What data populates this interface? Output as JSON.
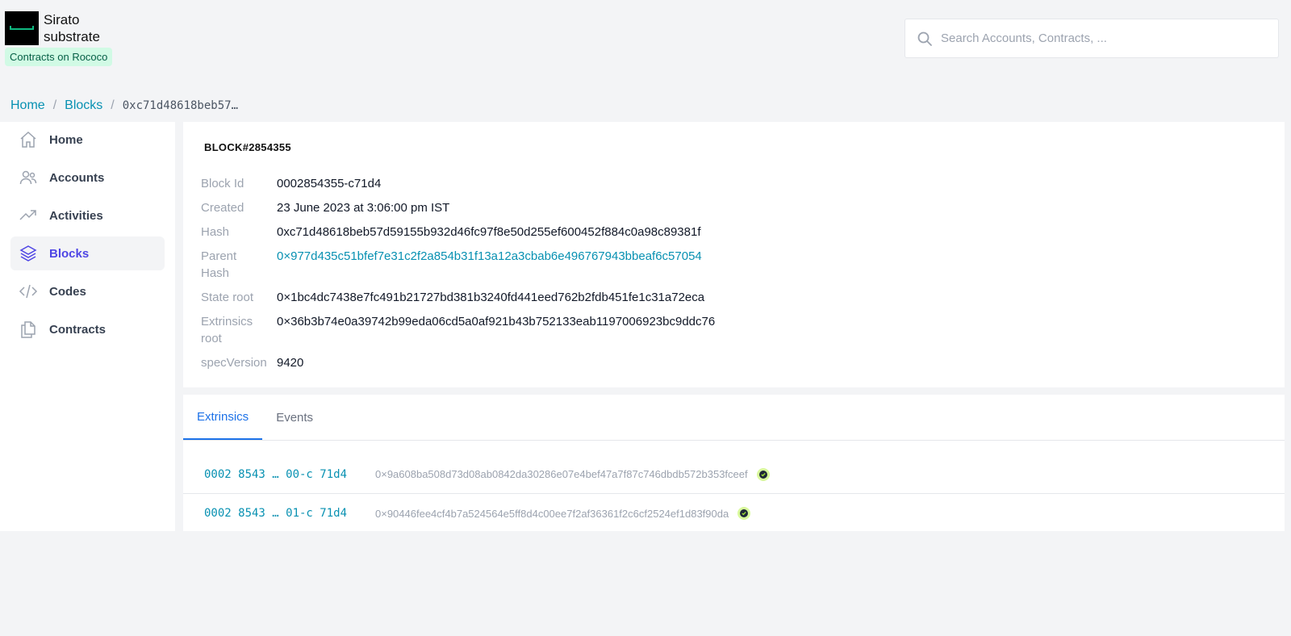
{
  "brand": {
    "name_line1": "Sirato",
    "name_line2": "substrate",
    "network": "Contracts on Rococo"
  },
  "search": {
    "placeholder": "Search Accounts, Contracts, ..."
  },
  "breadcrumb": {
    "home": "Home",
    "blocks": "Blocks",
    "current": "0xc71d48618beb57…"
  },
  "sidebar": {
    "items": [
      {
        "label": "Home",
        "icon": "home-icon"
      },
      {
        "label": "Accounts",
        "icon": "users-icon"
      },
      {
        "label": "Activities",
        "icon": "trend-icon"
      },
      {
        "label": "Blocks",
        "icon": "layers-icon",
        "active": true
      },
      {
        "label": "Codes",
        "icon": "code-icon"
      },
      {
        "label": "Contracts",
        "icon": "documents-icon"
      }
    ]
  },
  "block": {
    "title": "BLOCK#2854355",
    "fields": {
      "block_id": {
        "label": "Block Id",
        "value": "0002854355-c71d4"
      },
      "created": {
        "label": "Created",
        "value": "23 June 2023 at 3:06:00 pm IST"
      },
      "hash": {
        "label": "Hash",
        "value": "0xc71d48618beb57d59155b932d46fc97f8e50d255ef600452f884c0a98c89381f"
      },
      "parent_hash": {
        "label_line1": "Parent",
        "label_line2": "Hash",
        "value": "0×977d435c51bfef7e31c2f2a854b31f13a12a3cbab6e496767943bbeaf6c57054"
      },
      "state_root": {
        "label": "State root",
        "value": "0×1bc4dc7438e7fc491b21727bd381b3240fd441eed762b2fdb451fe1c31a72eca"
      },
      "extrinsics_root": {
        "label_line1": "Extrinsics",
        "label_line2": "root",
        "value": "0×36b3b74e0a39742b99eda06cd5a0af921b43b752133eab1197006923bc9ddc76"
      },
      "spec_version": {
        "label": "specVersion",
        "value": "9420"
      }
    }
  },
  "tabs": {
    "extrinsics": "Extrinsics",
    "events": "Events"
  },
  "extrinsics": [
    {
      "id": "0002 8543 … 00-c 71d4",
      "hash": "0×9a608ba508d73d08ab0842da30286e07e4bef47a7f87c746dbdb572b353fceef",
      "status": "check-circle-icon"
    },
    {
      "id": "0002 8543 … 01-c 71d4",
      "hash": "0×90446fee4cf4b7a524564e5ff8d4c00ee7f2af36361f2c6cf2524ef1d83f90da",
      "status": "check-circle-icon"
    }
  ],
  "colors": {
    "accent": "#1d72e8",
    "link": "#0891b2",
    "active_nav": "#4f46e5",
    "badge_bg": "#d1fae5",
    "status_ok": "#a3e635"
  }
}
